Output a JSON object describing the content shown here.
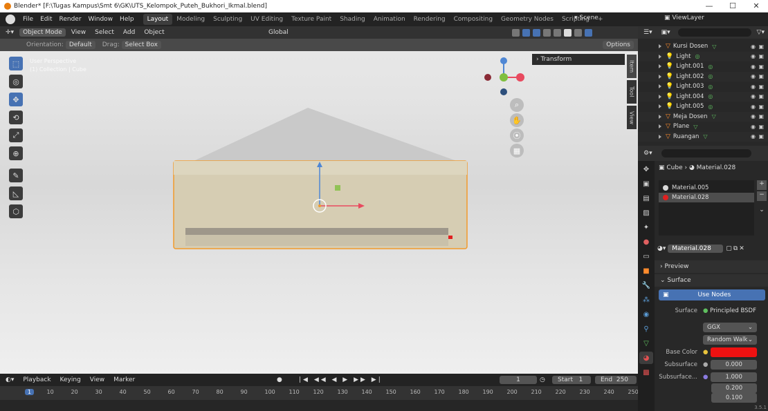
{
  "titlebar": {
    "title": "Blender* [F:\\Tugas Kampus\\Smt 6\\GK\\UTS_Kelompok_Puteh_Bukhori_Ikmal.blend]",
    "minimize": "—",
    "maximize": "☐",
    "close": "✕"
  },
  "menubar": {
    "menus": [
      "File",
      "Edit",
      "Render",
      "Window",
      "Help"
    ],
    "workspaces": [
      "Layout",
      "Modeling",
      "Sculpting",
      "UV Editing",
      "Texture Paint",
      "Shading",
      "Animation",
      "Rendering",
      "Compositing",
      "Geometry Nodes",
      "Scripting"
    ],
    "active_workspace": "Layout",
    "add_tab": "+",
    "scene": "Scene",
    "view_layer": "ViewLayer"
  },
  "viewport": {
    "mode": "Object Mode",
    "menus": [
      "View",
      "Select",
      "Add",
      "Object"
    ],
    "transform_orientation": "Global",
    "orientation_label": "Orientation:",
    "orientation_value": "Default",
    "drag_label": "Drag:",
    "drag_value": "Select Box",
    "options": "Options",
    "overlay_line1": "User Perspective",
    "overlay_line2": "(1) Collection | Cube",
    "transform_panel": "Transform",
    "side_tabs": [
      "Item",
      "Tool",
      "View"
    ],
    "gizmo_axes": {
      "x": "X",
      "y": "Y",
      "z": "Z"
    }
  },
  "timeline": {
    "menus": [
      "Playback",
      "Keying",
      "View",
      "Marker"
    ],
    "current_frame": "1",
    "start_label": "Start",
    "start_value": "1",
    "end_label": "End",
    "end_value": "250",
    "ticks": [
      "1",
      "10",
      "20",
      "30",
      "40",
      "50",
      "60",
      "70",
      "80",
      "90",
      "100",
      "110",
      "120",
      "130",
      "140",
      "150",
      "160",
      "170",
      "180",
      "190",
      "200",
      "210",
      "220",
      "230",
      "240",
      "250"
    ],
    "version": "3.5.1"
  },
  "outliner": {
    "items": [
      {
        "name": "Kursi Dosen",
        "type": "object"
      },
      {
        "name": "Light",
        "type": "light"
      },
      {
        "name": "Light.001",
        "type": "light"
      },
      {
        "name": "Light.002",
        "type": "light"
      },
      {
        "name": "Light.003",
        "type": "light"
      },
      {
        "name": "Light.004",
        "type": "light"
      },
      {
        "name": "Light.005",
        "type": "light"
      },
      {
        "name": "Meja Dosen",
        "type": "object"
      },
      {
        "name": "Plane",
        "type": "object"
      },
      {
        "name": "Ruangan",
        "type": "object"
      }
    ]
  },
  "properties": {
    "breadcrumb_object": "Cube",
    "breadcrumb_material": "Material.028",
    "material_slots": [
      {
        "name": "Material.005",
        "color": "#d8d8d8"
      },
      {
        "name": "Material.028",
        "color": "#e02020"
      }
    ],
    "selected_slot": "Material.028",
    "material_name": "Material.028",
    "sections": {
      "preview": "Preview",
      "surface": "Surface"
    },
    "use_nodes": "Use Nodes",
    "surface_label": "Surface",
    "surface_value": "Principled BSDF",
    "distribution": "GGX",
    "subsurface_method": "Random Walk",
    "base_color_label": "Base Color",
    "base_color": "#ee1111",
    "subsurface_label": "Subsurface",
    "subsurface_value": "0.000",
    "subsurface_radius_label": "Subsurface...",
    "subsurface_radius": [
      "1.000",
      "0.200",
      "0.100"
    ]
  },
  "colors": {
    "accent": "#4772b3",
    "object_outline": "#ff9b2d",
    "axis_x": "#e84a5f",
    "axis_y": "#7fbf3f",
    "axis_z": "#4f87d4"
  }
}
